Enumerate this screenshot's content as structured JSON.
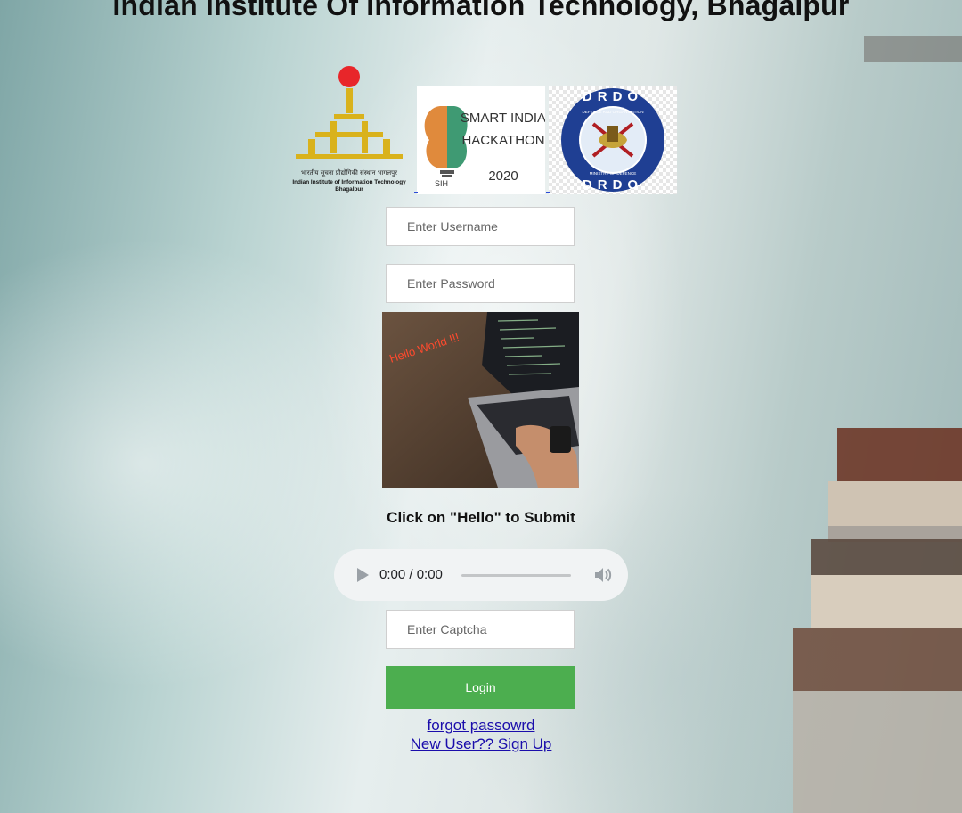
{
  "page": {
    "title": "Indian Institute Of Information Technology, Bhagalpur"
  },
  "logos": {
    "iiit": {
      "hindi": "भारतीय सूचना प्रौद्योगिकी संस्थान भागलपुर",
      "line1": "Indian Institute of Information Technology",
      "line2": "Bhagalpur"
    },
    "sih": {
      "line1": "SMART INDIA",
      "line2": "HACKATHON",
      "line3": "2020",
      "mark": "SIH"
    },
    "drdo": {
      "top": "DRDO",
      "bottom": "DRDO",
      "ring_top": "DEFENCE R&D ORGANISATION",
      "ring_bottom": "MINISTRY OF DEFENCE"
    }
  },
  "form": {
    "username_placeholder": "Enter Username",
    "password_placeholder": "Enter Password",
    "captcha_image_text": "Hello World !!!",
    "hint": "Click on \"Hello\" to Submit",
    "audio": {
      "time": "0:00 / 0:00",
      "progress": 0
    },
    "captcha_placeholder": "Enter Captcha",
    "login_label": "Login",
    "forgot_label": "forgot passowrd",
    "signup_label": "New User?? Sign Up"
  },
  "colors": {
    "login_button": "#4cae4f",
    "link": "#1a0dab",
    "iiit_gold": "#d9b21c",
    "iiit_red": "#e8262a",
    "drdo_blue": "#1f3f93"
  }
}
